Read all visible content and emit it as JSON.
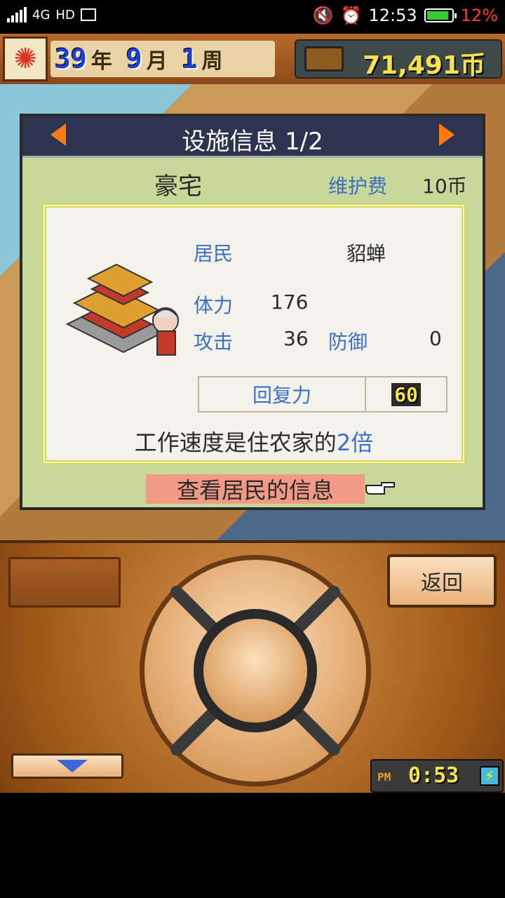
{
  "status_bar": {
    "network": "4G",
    "hd": "HD",
    "time": "12:53",
    "battery_pct": "12%",
    "battery_level": 0.12
  },
  "top_bar": {
    "year_num": "39",
    "year_unit": "年",
    "month_num": "9",
    "month_unit": "月",
    "week_num": "1",
    "week_unit": "周",
    "money": "71,491币"
  },
  "panel": {
    "title": "设施信息 1/2",
    "facility_name": "豪宅",
    "upkeep_label": "维护费",
    "upkeep_value": "10币",
    "resident_label": "居民",
    "resident_name": "貂蝉",
    "stamina_label": "体力",
    "stamina_value": "176",
    "attack_label": "攻击",
    "attack_value": "36",
    "defense_label": "防御",
    "defense_value": "0",
    "recovery_label": "回复力",
    "recovery_value": "60",
    "speed_text_prefix": "工作速度是住农家的",
    "speed_text_highlight": "2倍",
    "view_resident_button": "查看居民的信息"
  },
  "controller": {
    "back_button": "返回",
    "clock_period": "PM",
    "clock_time": "0:53"
  },
  "colors": {
    "label_blue": "#3d6fc4",
    "arrow_orange": "#ff7a10",
    "battery_red": "#ff3b30",
    "money_yellow": "#f6e24a"
  }
}
